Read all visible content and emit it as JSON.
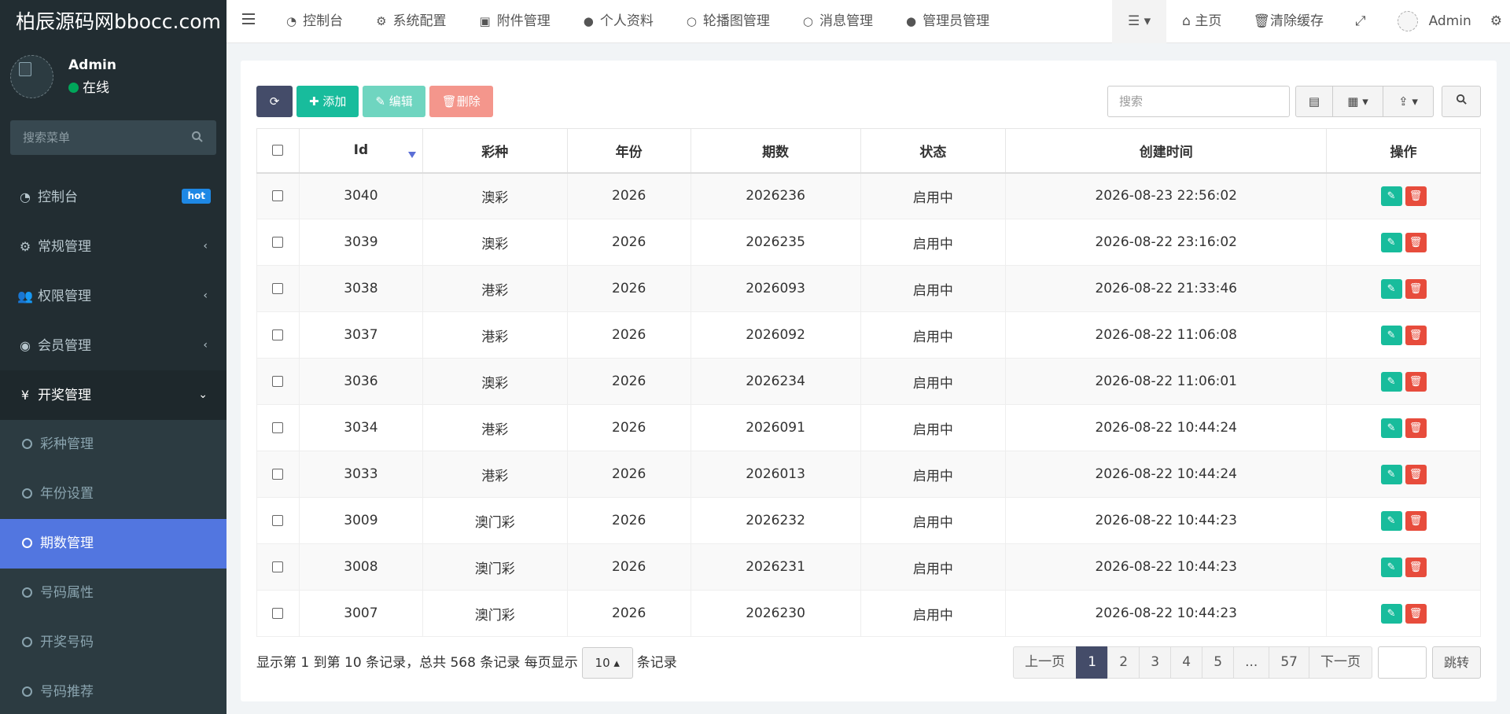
{
  "app": {
    "logo_text": "柏辰源码网bbocc.com"
  },
  "user": {
    "name": "Admin",
    "status": "在线"
  },
  "sidebar": {
    "search_placeholder": "搜索菜单",
    "menu": [
      {
        "label": "控制台",
        "icon": "dashboard-icon",
        "badge": "hot"
      },
      {
        "label": "常规管理",
        "icon": "cogs-icon",
        "caret": "‹"
      },
      {
        "label": "权限管理",
        "icon": "group-icon",
        "caret": "‹"
      },
      {
        "label": "会员管理",
        "icon": "user-circle-icon",
        "caret": "‹"
      },
      {
        "label": "开奖管理",
        "icon": "yen-icon",
        "caret": "⌄"
      }
    ],
    "submenu": [
      {
        "label": "彩种管理"
      },
      {
        "label": "年份设置"
      },
      {
        "label": "期数管理"
      },
      {
        "label": "号码属性"
      },
      {
        "label": "开奖号码"
      },
      {
        "label": "号码推荐"
      }
    ]
  },
  "navbar": {
    "tabs": [
      {
        "label": "控制台",
        "icon": "dashboard-icon"
      },
      {
        "label": "系统配置",
        "icon": "gear-icon"
      },
      {
        "label": "附件管理",
        "icon": "file-image-icon"
      },
      {
        "label": "个人资料",
        "icon": "user-icon"
      },
      {
        "label": "轮播图管理",
        "icon": "circle-icon"
      },
      {
        "label": "消息管理",
        "icon": "circle-icon"
      },
      {
        "label": "管理员管理",
        "icon": "user-icon"
      }
    ],
    "right": {
      "home": "主页",
      "clear_cache": "清除缓存",
      "admin": "Admin"
    }
  },
  "toolbar": {
    "add": "添加",
    "edit": "编辑",
    "delete": "删除",
    "search_placeholder": "搜索"
  },
  "table": {
    "headers": [
      "Id",
      "彩种",
      "年份",
      "期数",
      "状态",
      "创建时间",
      "操作"
    ],
    "rows": [
      {
        "id": "3040",
        "type": "澳彩",
        "year": "2026",
        "period": "2026236",
        "status": "启用中",
        "created": "2026-08-23 22:56:02"
      },
      {
        "id": "3039",
        "type": "澳彩",
        "year": "2026",
        "period": "2026235",
        "status": "启用中",
        "created": "2026-08-22 23:16:02"
      },
      {
        "id": "3038",
        "type": "港彩",
        "year": "2026",
        "period": "2026093",
        "status": "启用中",
        "created": "2026-08-22 21:33:46"
      },
      {
        "id": "3037",
        "type": "港彩",
        "year": "2026",
        "period": "2026092",
        "status": "启用中",
        "created": "2026-08-22 11:06:08"
      },
      {
        "id": "3036",
        "type": "澳彩",
        "year": "2026",
        "period": "2026234",
        "status": "启用中",
        "created": "2026-08-22 11:06:01"
      },
      {
        "id": "3034",
        "type": "港彩",
        "year": "2026",
        "period": "2026091",
        "status": "启用中",
        "created": "2026-08-22 10:44:24"
      },
      {
        "id": "3033",
        "type": "港彩",
        "year": "2026",
        "period": "2026013",
        "status": "启用中",
        "created": "2026-08-22 10:44:24"
      },
      {
        "id": "3009",
        "type": "澳门彩",
        "year": "2026",
        "period": "2026232",
        "status": "启用中",
        "created": "2026-08-22 10:44:23"
      },
      {
        "id": "3008",
        "type": "澳门彩",
        "year": "2026",
        "period": "2026231",
        "status": "启用中",
        "created": "2026-08-22 10:44:23"
      },
      {
        "id": "3007",
        "type": "澳门彩",
        "year": "2026",
        "period": "2026230",
        "status": "启用中",
        "created": "2026-08-22 10:44:23"
      }
    ]
  },
  "pagination": {
    "summary": "显示第 1 到第 10 条记录，总共 568 条记录 每页显示",
    "page_size": "10",
    "suffix": "条记录",
    "prev": "上一页",
    "pages": [
      "1",
      "2",
      "3",
      "4",
      "5",
      "...",
      "57"
    ],
    "next": "下一页",
    "jump": "跳转"
  }
}
